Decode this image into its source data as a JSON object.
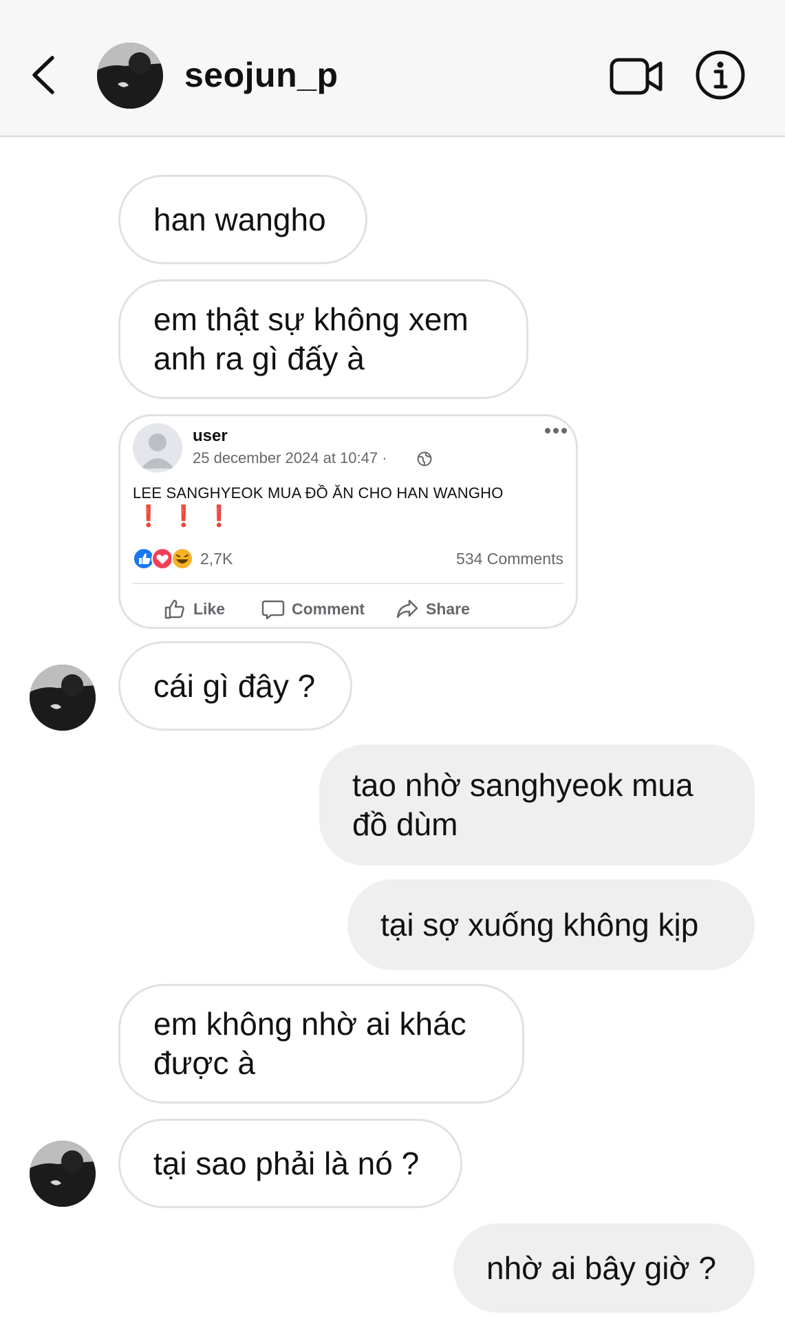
{
  "header": {
    "username": "seojun_p"
  },
  "messages": {
    "m1": "han wangho",
    "m2_line1": "em thật sự không xem",
    "m2_line2": "anh ra gì đấy à",
    "m3": "cái gì đây ?",
    "m4_line1": "tao nhờ sanghyeok mua",
    "m4_line2": "đồ dùm",
    "m5": "tại sợ xuống không kịp",
    "m6_line1": "em không nhờ ai khác",
    "m6_line2": "được à",
    "m7": "tại sao phải là nó ?",
    "m8": "nhờ ai bây giờ ?"
  },
  "post": {
    "user": "user",
    "timestamp": "25 december 2024 at 10:47 ·",
    "text": "LEE SANGHYEOK MUA ĐỒ ĂN CHO HAN WANGHO",
    "marks": "❗❗❗",
    "reaction_count": "2,7K",
    "comments": "534 Comments",
    "like_label": "Like",
    "comment_label": "Comment",
    "share_label": "Share"
  },
  "icons": {
    "back": "chevron-left-icon",
    "video": "video-call-icon",
    "info": "info-icon"
  },
  "colors": {
    "outgoing_bubble": "#efefef",
    "incoming_border": "#e1e1e1",
    "like_blue": "#1877f2",
    "love_red": "#f33e58",
    "alert_red": "#e02424"
  }
}
